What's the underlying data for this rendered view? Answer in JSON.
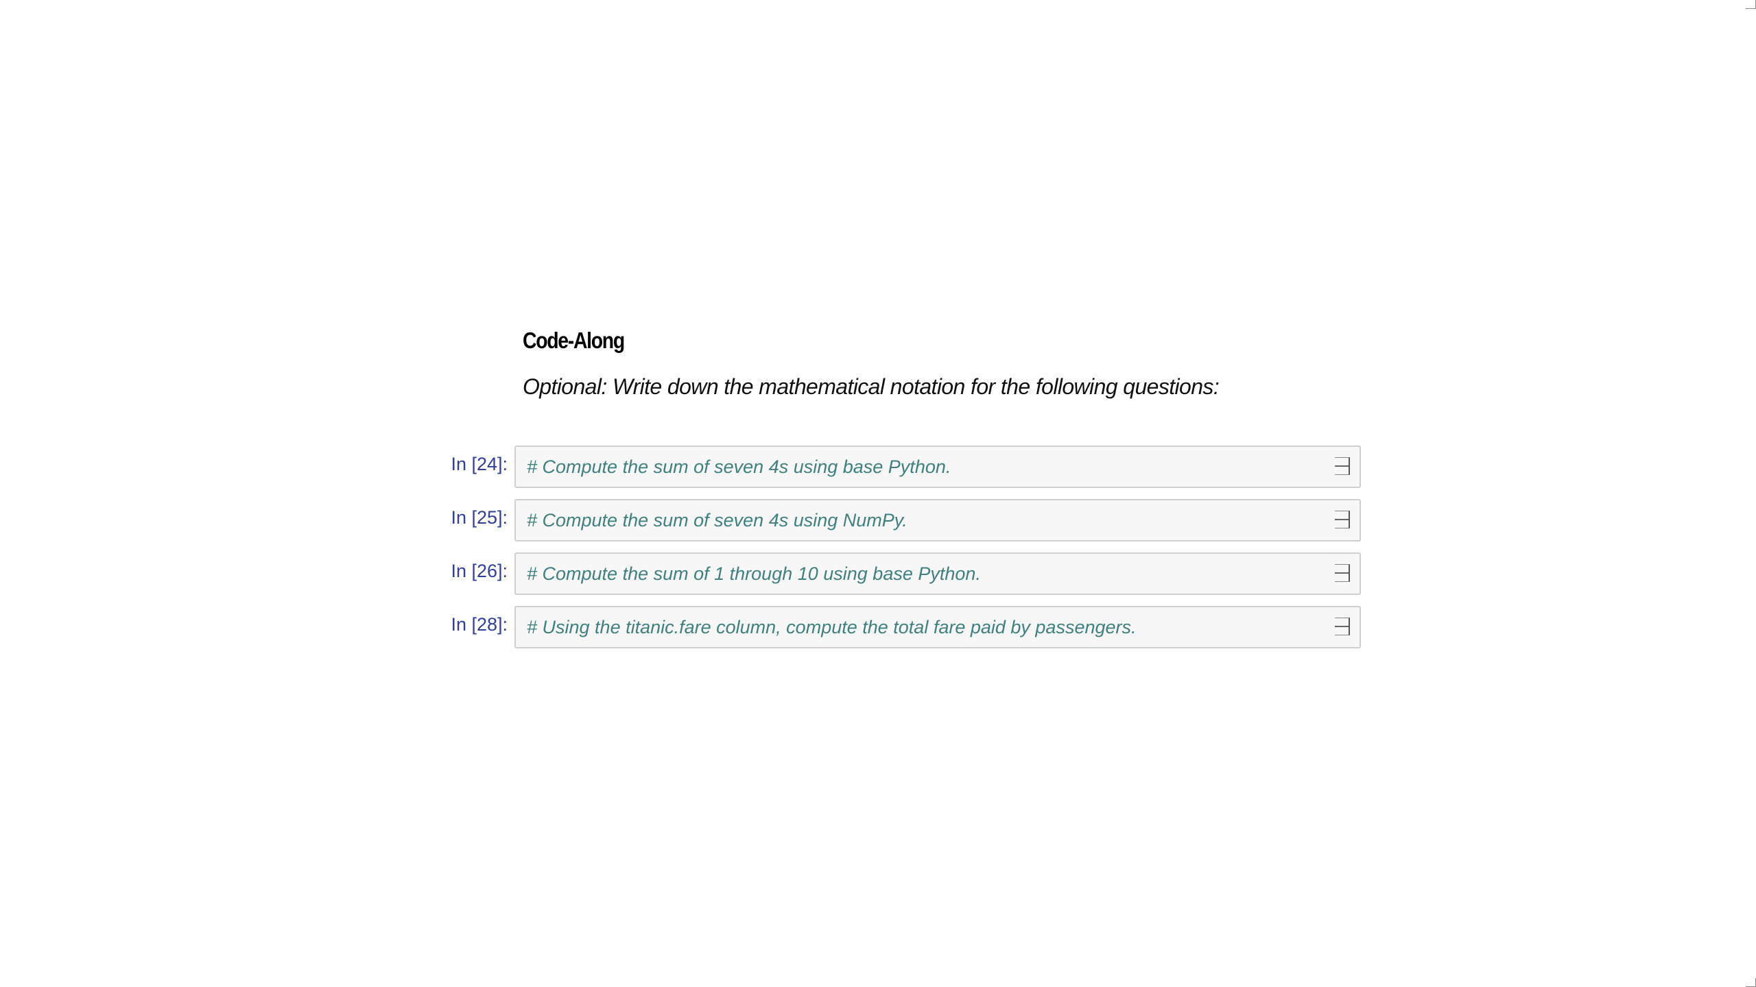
{
  "heading": "Code-Along",
  "subtitle": "Optional: Write down the mathematical notation for the following questions:",
  "cells": [
    {
      "prompt": "In [24]:",
      "code": "# Compute the sum of seven 4s using base Python."
    },
    {
      "prompt": "In [25]:",
      "code": "# Compute the sum of seven 4s using NumPy."
    },
    {
      "prompt": "In [26]:",
      "code": "# Compute the sum of 1 through 10 using base Python."
    },
    {
      "prompt": "In [28]:",
      "code": "# Using the titanic.fare column, compute the total fare paid by passengers."
    }
  ],
  "colors": {
    "prompt": "#303f9f",
    "comment": "#408080",
    "cell_background": "#f7f7f7",
    "cell_border": "#cfcfcf"
  },
  "icons": {
    "cell_toggle": "collapse-icon",
    "window_corner": "resize-corner-icon"
  }
}
